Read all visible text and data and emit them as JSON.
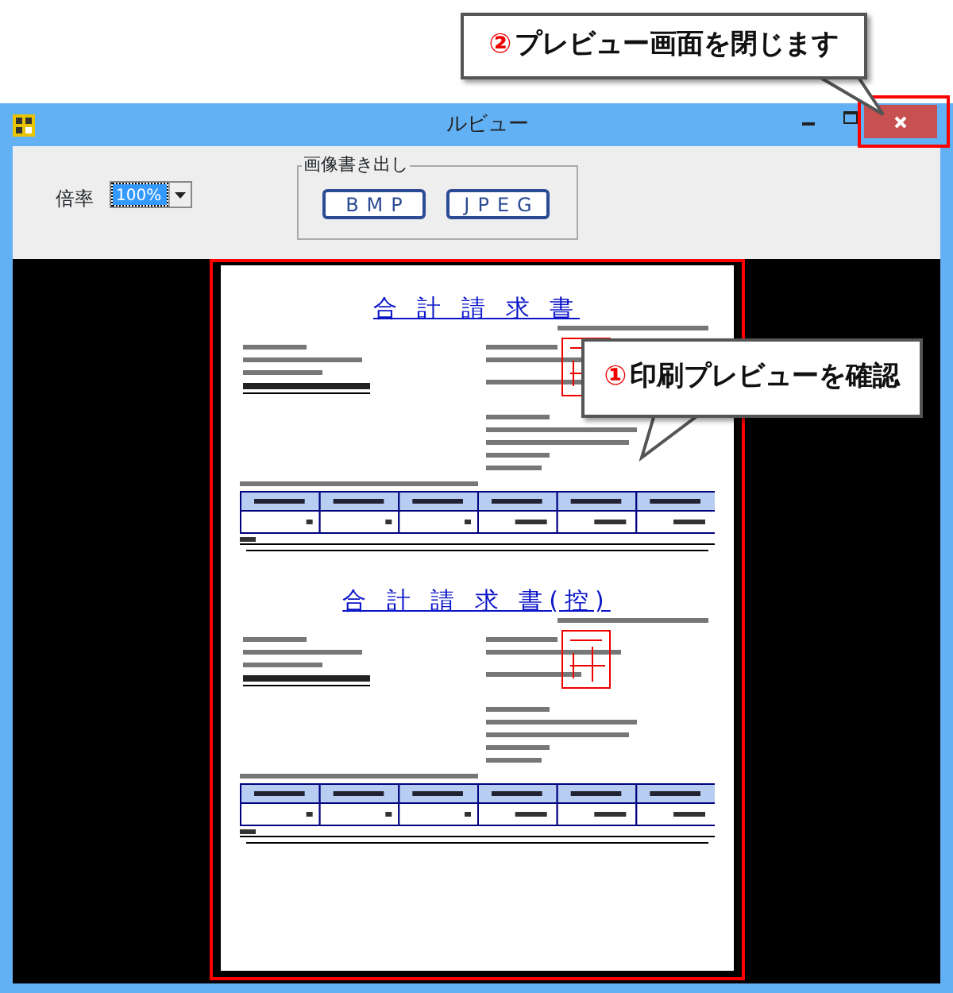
{
  "callouts": [
    {
      "number": "②",
      "text": "プレビュー画面を閉じます"
    },
    {
      "number": "①",
      "text": "印刷プレビューを確認"
    }
  ],
  "window": {
    "title": "ルビュー"
  },
  "toolbar": {
    "zoom_label": "倍率",
    "zoom_value": "100%",
    "export_group": "画像書き出し",
    "buttons": [
      "BMP",
      "JPEG"
    ]
  },
  "documents": [
    {
      "title": "合 計 請 求 書"
    },
    {
      "title": "合 計 請 求 書(控)"
    }
  ]
}
